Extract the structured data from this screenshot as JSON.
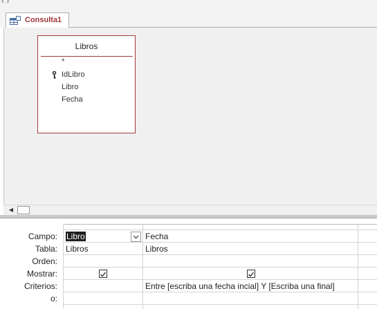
{
  "document_tab": {
    "label": "Consulta1",
    "icon": "query-design-icon"
  },
  "table_box": {
    "title": "Libros",
    "fields": [
      "*",
      "IdLibro",
      "Libro",
      "Fecha"
    ],
    "primary_key": "IdLibro"
  },
  "grid": {
    "row_labels": {
      "campo": "Campo:",
      "tabla": "Tabla:",
      "orden": "Orden:",
      "mostrar": "Mostrar:",
      "criterios": "Criterios:",
      "o": "o:"
    },
    "columns": [
      {
        "campo": "Libro",
        "tabla": "Libros",
        "orden": "",
        "mostrar": true,
        "criterios": ""
      },
      {
        "campo": "Fecha",
        "tabla": "Libros",
        "orden": "",
        "mostrar": true,
        "criterios": "Entre [escriba una fecha incial] Y [Escriba una final]"
      }
    ]
  },
  "colors": {
    "accent": "#a4373a",
    "selection": "#1f1f1f"
  }
}
